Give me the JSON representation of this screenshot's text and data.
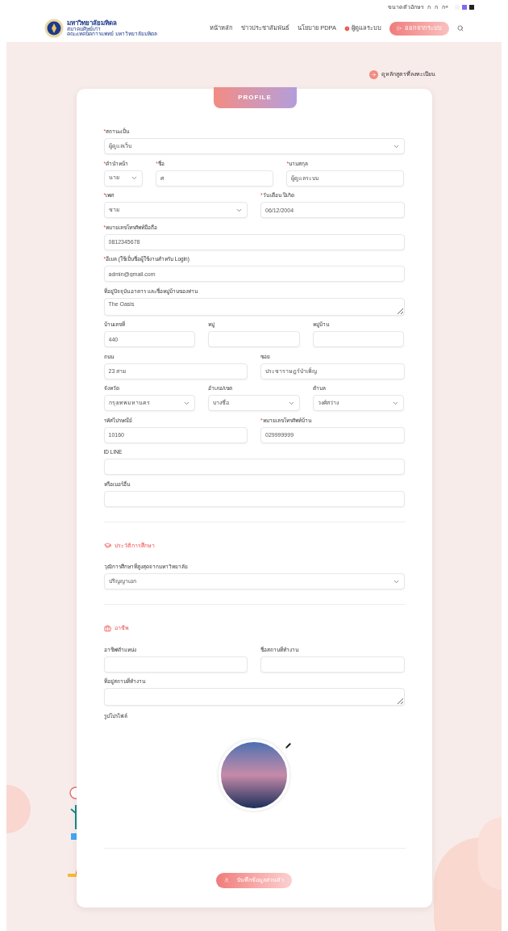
{
  "topbar": {
    "font_size_label": "ขนาดตัวอักษร",
    "font_sizes": [
      "ก",
      "ก",
      "ก+"
    ]
  },
  "header": {
    "logo_lines": [
      "มหาวิทยาลัยมหิดล",
      "สมาคมศิษย์เก่า",
      "คณะเทคนิคการแพทย์ มหาวิทยาลัยมหิดล"
    ],
    "nav": [
      {
        "label": "หน้าหลัก",
        "alert": false
      },
      {
        "label": "ข่าวประชาสัมพันธ์",
        "alert": false
      },
      {
        "label": "นโยบาย PDPA",
        "alert": false
      },
      {
        "label": "ผู้ดูแลระบบ",
        "alert": true
      }
    ],
    "logout_button": "ออกจากระบบ"
  },
  "course_link": "ดูหลักสูตรที่ลงทะเบียน",
  "card_tab": "PROFILE",
  "required_mark": "*",
  "sections": [
    {
      "rows": [
        [
          {
            "label": "สถานะเป็น",
            "required": true,
            "kind": "select",
            "value": "ผู้ดูแลเว็บ"
          }
        ],
        [
          {
            "label": "คำนำหน้า",
            "required": true,
            "kind": "select",
            "value": "นาย"
          },
          {
            "label": "ชื่อ",
            "required": true,
            "kind": "text",
            "value": "ศ"
          },
          {
            "label": "นามสกุล",
            "required": true,
            "kind": "text",
            "value": "ผู้ดูแลระบบ"
          }
        ],
        [
          {
            "label": "เพศ",
            "required": true,
            "kind": "select",
            "value": "ชาย"
          },
          {
            "label": "วัน เดือน ปีเกิด",
            "required": true,
            "kind": "text",
            "value": "06/12/2004"
          }
        ],
        [
          {
            "label": "หมายเลขโทรศัพท์มือถือ",
            "required": true,
            "kind": "text",
            "value": "0812345678"
          }
        ],
        [
          {
            "label": "อีเมล (ใช้เป็นชื่อผู้ใช้งานสำหรับ Login)",
            "required": true,
            "kind": "text",
            "value": "admin@gmail.com"
          }
        ],
        [
          {
            "label": "ที่อยู่ปัจจุบัน อาคาร และชื่อหมู่บ้านของท่าน",
            "required": false,
            "kind": "textarea",
            "value": "The Oasis"
          }
        ],
        [
          {
            "label": "บ้านเลขที่",
            "required": false,
            "kind": "text",
            "value": "440"
          },
          {
            "label": "หมู่",
            "required": false,
            "kind": "text"
          },
          {
            "label": "หมู่บ้าน",
            "required": false,
            "kind": "text"
          }
        ],
        [
          {
            "label": "ถนน",
            "required": false,
            "kind": "text",
            "value": "23 สาย"
          },
          {
            "label": "ซอย",
            "required": false,
            "kind": "text",
            "value": "ประชาราษฎร์บำเพ็ญ"
          }
        ],
        [
          {
            "label": "จังหวัด",
            "required": false,
            "kind": "select",
            "value": "กรุงเทพมหานคร"
          },
          {
            "label": "อำเภอ/เขต",
            "required": false,
            "kind": "select",
            "value": "บางซื่อ"
          },
          {
            "label": "ตำบล",
            "required": false,
            "kind": "select",
            "value": "วงศ์สว่าง"
          }
        ],
        [
          {
            "label": "รหัสไปรษณีย์",
            "required": false,
            "kind": "text",
            "value": "10160"
          },
          {
            "label": "หมายเลขโทรศัพท์บ้าน",
            "required": true,
            "kind": "text",
            "value": "029999999"
          }
        ],
        [
          {
            "label": "ID LINE",
            "required": false,
            "kind": "text"
          }
        ],
        [
          {
            "label": "หรือเบอร์อื่น",
            "required": false,
            "kind": "text"
          }
        ]
      ]
    },
    {
      "kind": "education",
      "title": "ประวัติการศึกษา",
      "rows": [
        [
          {
            "label": "วุฒิการศึกษาที่สูงสุดจากมหาวิทยาลัย",
            "required": false,
            "kind": "select",
            "value": "ปริญญาเอก"
          }
        ]
      ]
    },
    {
      "kind": "career",
      "title": "อาชีพ",
      "rows": [
        [
          {
            "label": "อาชีพ/ตำแหน่ง",
            "required": false,
            "kind": "text"
          },
          {
            "label": "ชื่อสถานที่ทำงาน",
            "required": false,
            "kind": "text"
          }
        ],
        [
          {
            "label": "ที่อยู่สถานที่ทำงาน",
            "required": false,
            "kind": "textarea"
          }
        ]
      ]
    }
  ],
  "photo_label": "รูปโปรไฟล์",
  "save_button": "บันทึกข้อมูลส่วนตัว"
}
